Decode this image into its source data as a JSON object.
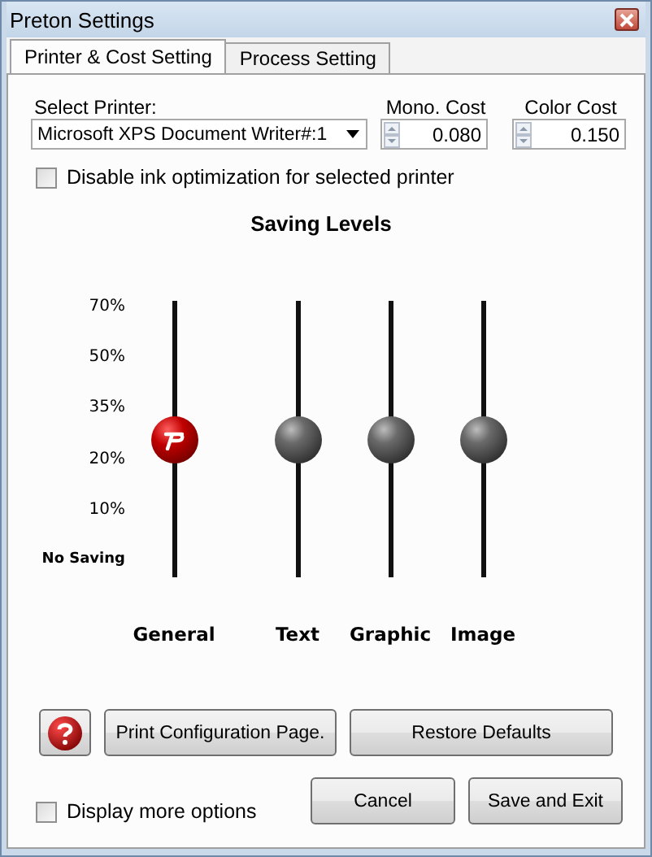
{
  "window": {
    "title": "Preton Settings"
  },
  "tabs": [
    {
      "label": "Printer & Cost Setting",
      "selected": true
    },
    {
      "label": "Process Setting",
      "selected": false
    }
  ],
  "printer": {
    "label": "Select Printer:",
    "value": "Microsoft XPS Document Writer#:1"
  },
  "costs": [
    {
      "label": "Mono. Cost",
      "value": "0.080"
    },
    {
      "label": "Color Cost",
      "value": "0.150"
    }
  ],
  "ink_optimization": {
    "label": "Disable ink optimization for selected printer",
    "checked": false
  },
  "saving_levels": {
    "title": "Saving Levels",
    "scale": [
      "70%",
      "50%",
      "35%",
      "20%",
      "10%",
      "No Saving"
    ],
    "sliders": [
      {
        "label": "General",
        "level": 0.5,
        "selected": true
      },
      {
        "label": "Text",
        "level": 0.5,
        "selected": false
      },
      {
        "label": "Graphic",
        "level": 0.5,
        "selected": false
      },
      {
        "label": "Image",
        "level": 0.5,
        "selected": false
      }
    ]
  },
  "buttons": [
    "Print Configuration Page.",
    "Restore Defaults"
  ],
  "more_options": {
    "label": "Display more options",
    "checked": false
  },
  "action_buttons": [
    "Cancel",
    "Save and Exit"
  ]
}
